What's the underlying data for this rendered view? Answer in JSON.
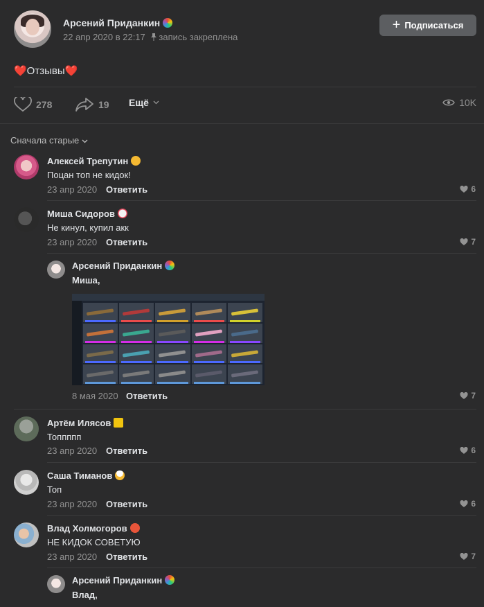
{
  "post": {
    "author": "Арсений Приданкин",
    "date": "22 апр 2020 в 22:17",
    "pinned_text": "запись закреплена",
    "subscribe_label": "Подписаться",
    "text": "❤️Отзывы❤️",
    "likes": "278",
    "shares": "19",
    "more_label": "Ещё",
    "views": "10K"
  },
  "sort_label": "Сначала старые",
  "comments": [
    {
      "name": "Алексей Трепутин",
      "text": "Поцан топ не кидок!",
      "date": "23 апр 2020",
      "reply": "Ответить",
      "likes": "6",
      "emoji": "smiling-face-emoji"
    },
    {
      "name": "Миша Сидоров",
      "text": "Не кинул, купил акк",
      "date": "23 апр 2020",
      "reply": "Ответить",
      "likes": "7",
      "emoji": "clown-emoji"
    },
    {
      "name": "Арсений Приданкин",
      "text": "Миша,",
      "date": "8 мая 2020",
      "reply": "Ответить",
      "likes": "7",
      "emoji": "rainbow-emoji"
    },
    {
      "name": "Артём Илясов",
      "text": "Топпппп",
      "date": "23 апр 2020",
      "reply": "Ответить",
      "likes": "6",
      "emoji": "crown-emoji"
    },
    {
      "name": "Саша Тиманов",
      "text": "Топ",
      "date": "23 апр 2020",
      "reply": "Ответить",
      "likes": "6",
      "emoji": "cook-emoji"
    },
    {
      "name": "Влад Холмогоров",
      "text": "НЕ КИДОК СОВЕТУЮ",
      "date": "23 апр 2020",
      "reply": "Ответить",
      "likes": "7",
      "emoji": "angry-face-emoji"
    },
    {
      "name": "Арсений Приданкин",
      "text": "Влад,",
      "emoji": "rainbow-emoji"
    }
  ],
  "colors": {
    "background": "#2b2b2c",
    "muted": "#939393",
    "divider": "#3b3b3c",
    "button": "#5c5e61"
  }
}
